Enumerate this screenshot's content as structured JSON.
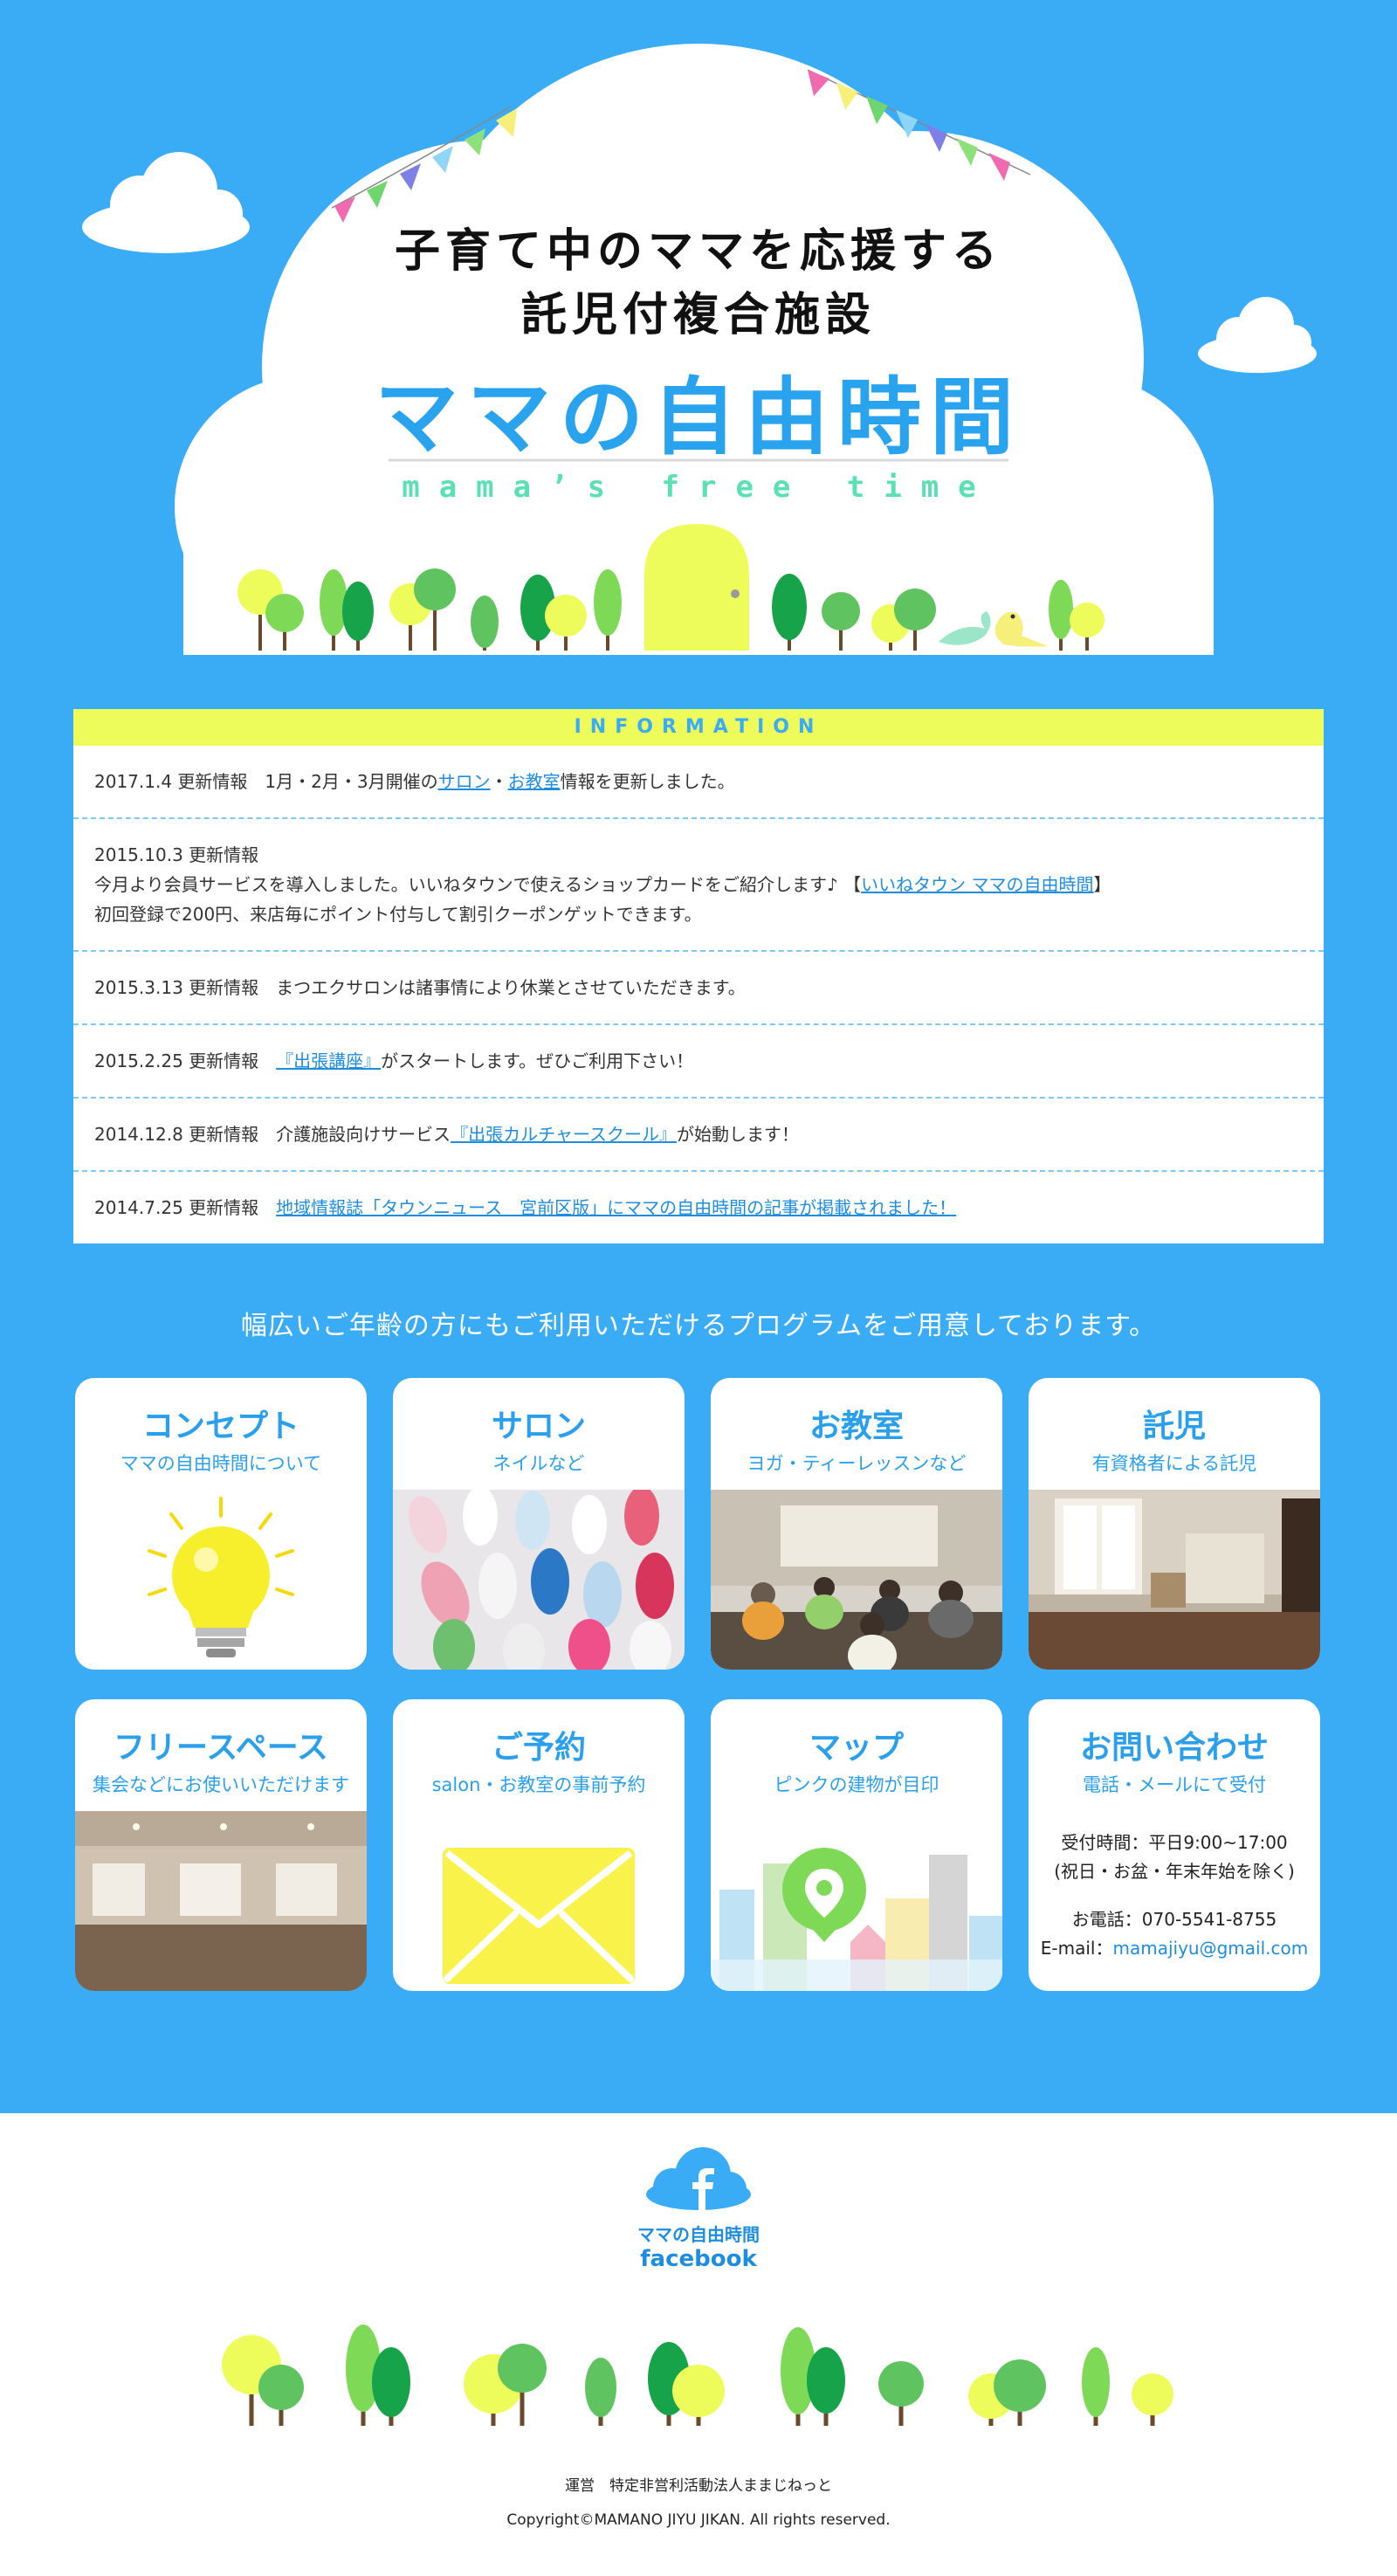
{
  "hero": {
    "line1": "子育て中のママを応援する",
    "line2": "託児付複合施設",
    "logo": "ママの自由時間",
    "logo_sub": "mama’s free time"
  },
  "info": {
    "header": "INFORMATION",
    "rows": [
      {
        "date": "2017.1.4 更新情報",
        "t1": "1月・2月・3月開催の",
        "l1": "サロン",
        "t2": "・",
        "l2": "お教室",
        "t3": "情報を更新しました。"
      },
      {
        "date": "2015.10.3 更新情報",
        "line1": "今月より会員サービスを導入しました。いいねタウンで使えるショップカードをご紹介します♪ 【",
        "link": "いいねタウン ママの自由時間",
        "line1_end": "】",
        "line2": "初回登録で200円、来店毎にポイント付与して割引クーポンゲットできます。"
      },
      {
        "date": "2015.3.13 更新情報",
        "text": "まつエクサロンは諸事情により休業とさせていただきます。"
      },
      {
        "date": "2015.2.25 更新情報",
        "link": "『出張講座』",
        "text": "がスタートします。ぜひご利用下さい！"
      },
      {
        "date": "2014.12.8 更新情報",
        "text": "介護施設向けサービス",
        "link": "『出張カルチャースクール』",
        "text2": "が始動します！"
      },
      {
        "date": "2014.7.25 更新情報",
        "link": "地域情報誌「タウンニュース　宮前区版」にママの自由時間の記事が掲載されました！"
      }
    ]
  },
  "lead": "幅広いご年齢の方にもご利用いただけるプログラムをご用意しております。",
  "cards": [
    {
      "title": "コンセプト",
      "sub": "ママの自由時間について",
      "icon": "lightbulb-icon"
    },
    {
      "title": "サロン",
      "sub": "ネイルなど",
      "icon": "nail-photo"
    },
    {
      "title": "お教室",
      "sub": "ヨガ・ティーレッスンなど",
      "icon": "yoga-photo"
    },
    {
      "title": "託児",
      "sub": "有資格者による託児",
      "icon": "nursery-photo"
    },
    {
      "title": "フリースペース",
      "sub": "集会などにお使いいただけます",
      "icon": "room-photo"
    },
    {
      "title": "ご予約",
      "sub": "salon・お教室の事前予約",
      "icon": "envelope-icon"
    },
    {
      "title": "マップ",
      "sub": "ピンクの建物が目印",
      "icon": "map-pin-icon"
    },
    {
      "title": "お問い合わせ",
      "sub": "電話・メールにて受付",
      "hours": "受付時間：平日9:00~17:00",
      "closed": "(祝日・お盆・年末年始を除く)",
      "phone": "お電話：070-5541-8755",
      "email_label": "E-mail：",
      "email": "mamajiyu@gmail.com"
    }
  ],
  "footer": {
    "fb_name": "ママの自由時間",
    "fb_word": "facebook",
    "org": "運営　特定非営利活動法人ままじねっと",
    "copyright": "Copyright©MAMANO JIYU JIKAN. All rights reserved."
  },
  "colors": {
    "bg_blue": "#3aabf5",
    "accent_yellow": "#eefc5b",
    "title_blue": "#2aa0ec",
    "tree_green": "#7ed957"
  }
}
